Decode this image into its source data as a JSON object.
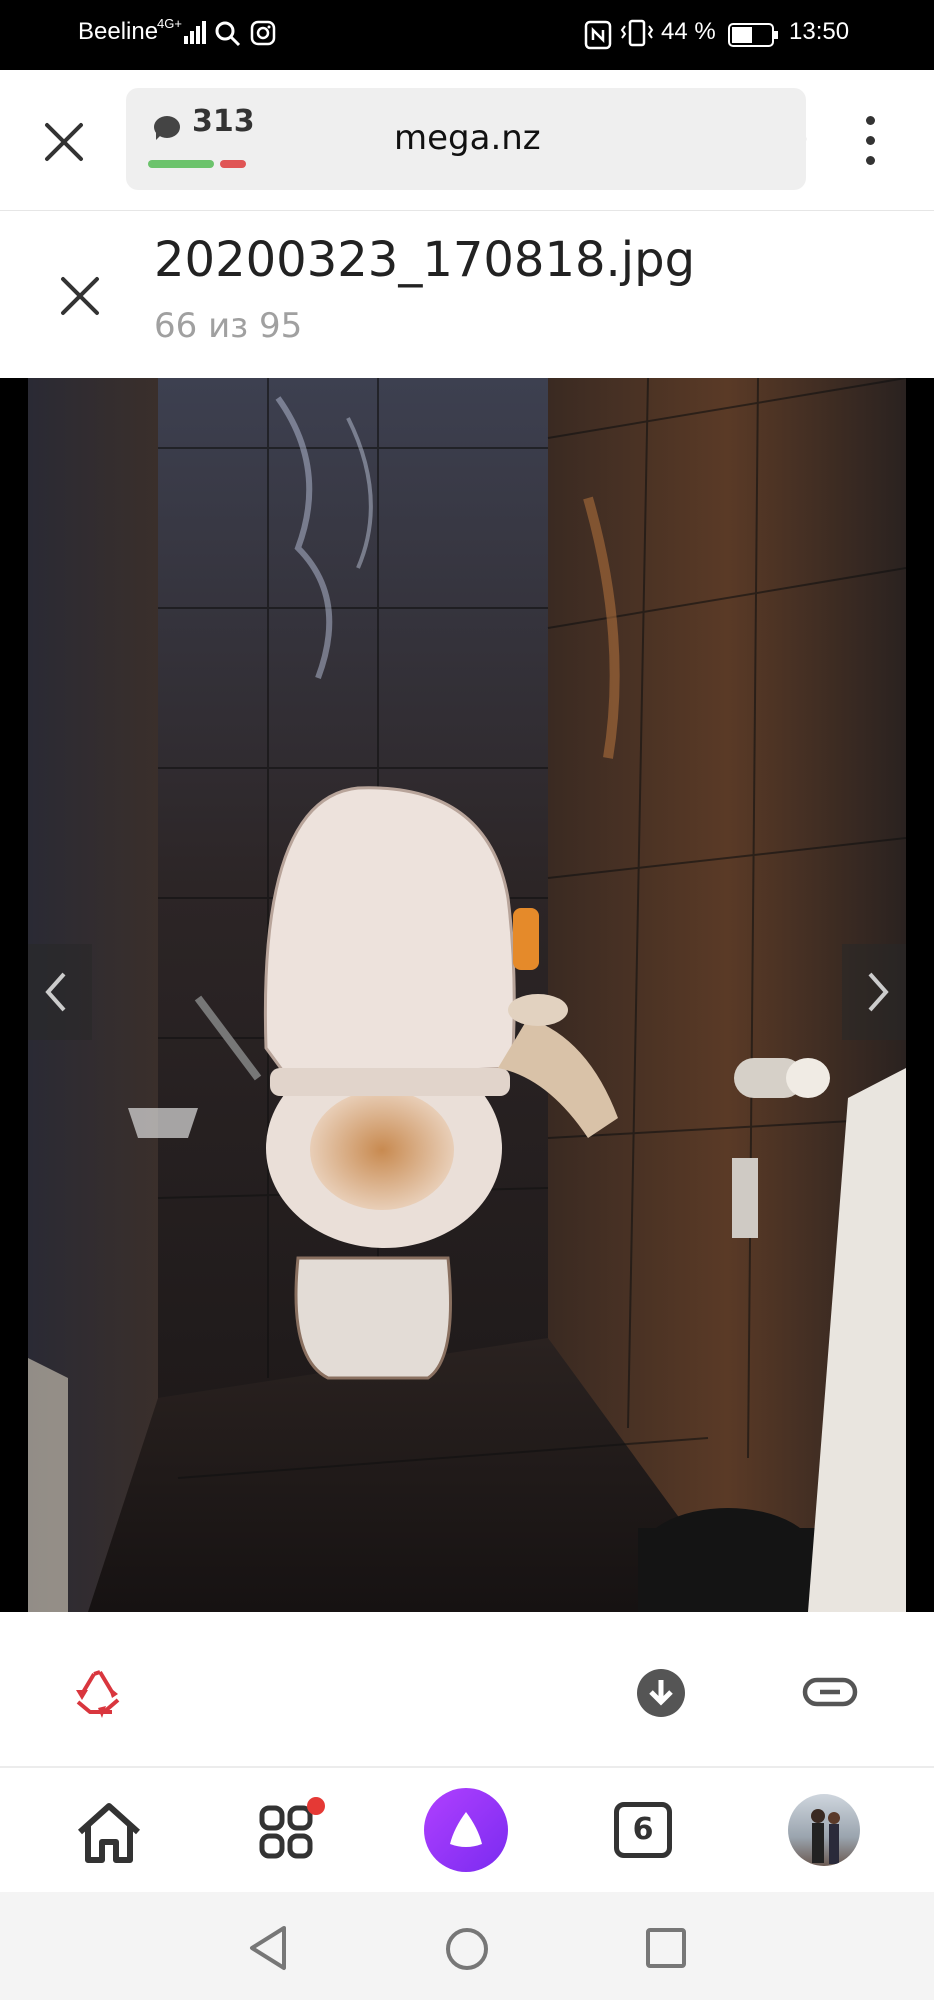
{
  "status_bar": {
    "carrier": "Beeline",
    "network": "4G+",
    "battery": "44 %",
    "time": "13:50"
  },
  "browser": {
    "url": "mega.nz",
    "comment_count": "313"
  },
  "file": {
    "name": "20200323_170818.jpg",
    "counter": "66 из 95"
  },
  "bottom_nav": {
    "tabs_count": "6"
  },
  "colors": {
    "accent": "#8a2be2",
    "rubbish": "#d9363e",
    "badge": "#e53935"
  }
}
